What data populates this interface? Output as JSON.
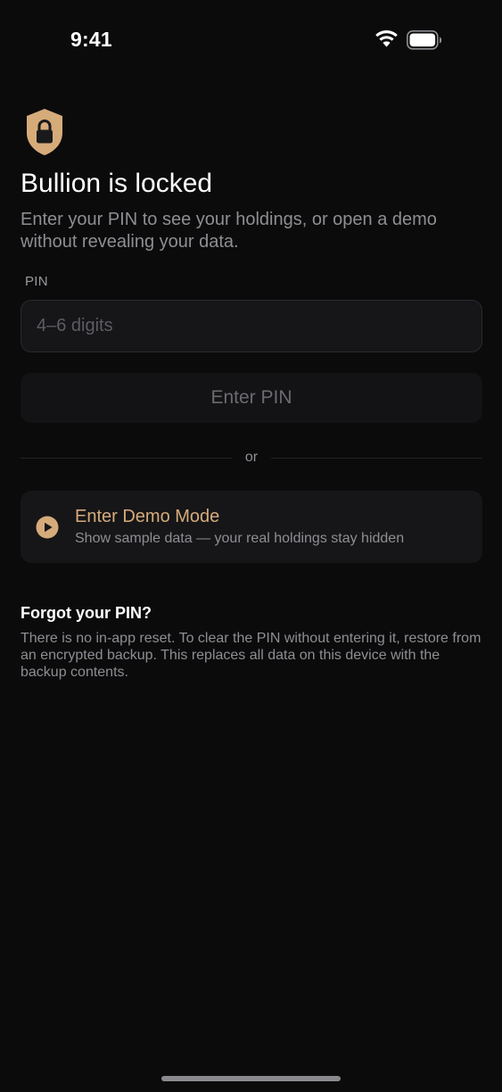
{
  "status_bar": {
    "time": "9:41",
    "wifi_icon": "wifi-icon",
    "battery_icon": "battery-icon"
  },
  "lock": {
    "icon": "shield-lock-icon",
    "title": "Bullion is locked",
    "subtitle": "Enter your PIN to see your holdings, or open a demo without revealing your data."
  },
  "pin": {
    "label": "PIN",
    "value": "",
    "placeholder": "4–6 digits",
    "button_label": "Enter PIN"
  },
  "divider_text": "or",
  "demo": {
    "icon": "play-icon",
    "title": "Enter Demo Mode",
    "subtitle": "Show sample data — your real holdings stay hidden"
  },
  "forgot": {
    "heading": "Forgot your PIN?",
    "body": "There is no in-app reset. To clear the PIN without entering it, restore from an encrypted backup. This replaces all data on this device with the backup contents."
  },
  "colors": {
    "background": "#0b0b0c",
    "accent": "#d6ab7a",
    "surface": "#161618",
    "muted_text": "#8e8e93"
  }
}
